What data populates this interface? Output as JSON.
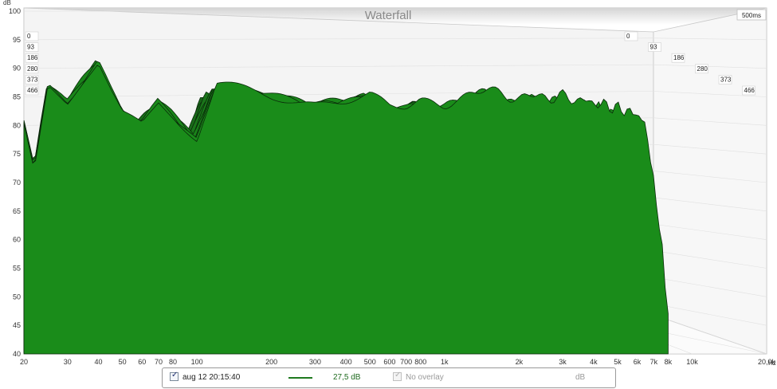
{
  "chart_data": {
    "type": "waterfall",
    "title": "Waterfall",
    "time_window_label": "500ms",
    "y_unit": "dB",
    "x_unit": "Hz",
    "ylim": [
      40,
      100
    ],
    "y_ticks": [
      40,
      45,
      50,
      55,
      60,
      65,
      70,
      75,
      80,
      85,
      90,
      95,
      100
    ],
    "x_scale": "log",
    "xlim": [
      20,
      20000
    ],
    "x_ticks": [
      {
        "value": 20,
        "label": "20"
      },
      {
        "value": 30,
        "label": "30"
      },
      {
        "value": 40,
        "label": "40"
      },
      {
        "value": 50,
        "label": "50"
      },
      {
        "value": 60,
        "label": "60"
      },
      {
        "value": 70,
        "label": "70"
      },
      {
        "value": 80,
        "label": "80"
      },
      {
        "value": 100,
        "label": "100"
      },
      {
        "value": 200,
        "label": "200"
      },
      {
        "value": 300,
        "label": "300"
      },
      {
        "value": 400,
        "label": "400"
      },
      {
        "value": 500,
        "label": "500"
      },
      {
        "value": 600,
        "label": "600"
      },
      {
        "value": 700,
        "label": "700"
      },
      {
        "value": 800,
        "label": "800"
      },
      {
        "value": 1000,
        "label": "1k"
      },
      {
        "value": 2000,
        "label": "2k"
      },
      {
        "value": 3000,
        "label": "3k"
      },
      {
        "value": 4000,
        "label": "4k"
      },
      {
        "value": 5000,
        "label": "5k"
      },
      {
        "value": 6000,
        "label": "6k"
      },
      {
        "value": 7000,
        "label": "7k"
      },
      {
        "value": 8000,
        "label": "8k"
      },
      {
        "value": 10000,
        "label": "10k"
      },
      {
        "value": 20000,
        "label": "20,0k"
      }
    ],
    "time_slices_ms": [
      "0",
      "93",
      "186",
      "280",
      "373",
      "466"
    ],
    "series": [
      {
        "name": "aug 12 20:15:40",
        "color": "#1a7a1a",
        "front_response": [
          [
            20,
            80
          ],
          [
            22,
            72
          ],
          [
            25,
            87
          ],
          [
            30,
            84
          ],
          [
            35,
            88
          ],
          [
            40,
            91
          ],
          [
            45,
            86
          ],
          [
            50,
            82
          ],
          [
            60,
            80
          ],
          [
            70,
            84
          ],
          [
            80,
            82
          ],
          [
            100,
            78
          ],
          [
            120,
            87
          ],
          [
            150,
            86
          ],
          [
            200,
            85
          ],
          [
            300,
            84
          ],
          [
            400,
            85
          ],
          [
            500,
            86
          ],
          [
            600,
            84
          ],
          [
            700,
            84
          ],
          [
            800,
            85
          ],
          [
            1000,
            84
          ],
          [
            1500,
            86
          ],
          [
            2000,
            85
          ],
          [
            3000,
            85
          ],
          [
            4000,
            84
          ],
          [
            5000,
            83
          ],
          [
            6000,
            82
          ],
          [
            6500,
            80
          ],
          [
            7000,
            70
          ],
          [
            7500,
            60
          ],
          [
            8000,
            47
          ]
        ]
      }
    ]
  },
  "legend": {
    "series_checked": true,
    "series_label": "aug 12 20:15:40",
    "series_offset": "27,5 dB",
    "overlay_checked": true,
    "overlay_label": "No overlay",
    "overlay_unit": "dB"
  }
}
